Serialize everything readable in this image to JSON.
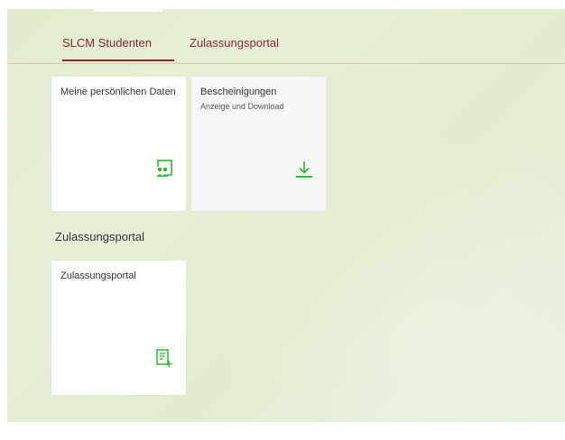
{
  "tabs": [
    {
      "label": "SLCM Studenten",
      "active": true
    },
    {
      "label": "Zulassungsportal",
      "active": false
    }
  ],
  "tiles": [
    {
      "title": "Meine persönlichen Daten",
      "subtitle": "",
      "icon": "person-group-icon"
    },
    {
      "title": "Bescheinigungen",
      "subtitle": "Anzeige und Download",
      "icon": "download-icon"
    }
  ],
  "group": {
    "title": "Zulassungsportal",
    "tiles": [
      {
        "title": "Zulassungsportal",
        "subtitle": "",
        "icon": "add-document-icon"
      }
    ]
  },
  "colors": {
    "accent": "#8a2828",
    "icon_green": "#2eb82e",
    "background": "#e5edd3",
    "tile": "#ffffff"
  }
}
